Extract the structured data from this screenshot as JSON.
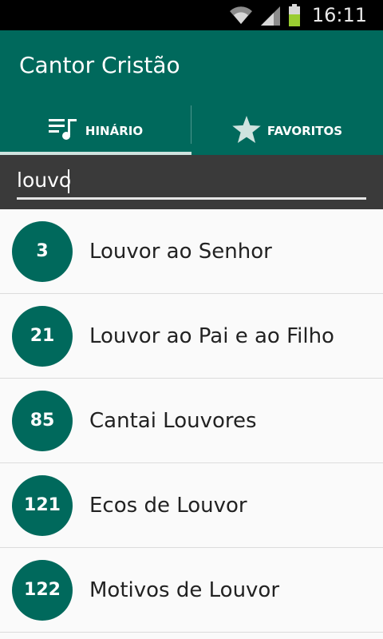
{
  "status_bar": {
    "time": "16:11"
  },
  "app": {
    "title": "Cantor Cristão"
  },
  "tabs": [
    {
      "label": "HINÁRIO",
      "icon": "playlist-music-icon",
      "active": true
    },
    {
      "label": "FAVORITOS",
      "icon": "star-icon",
      "active": false
    }
  ],
  "search": {
    "value": "louvo"
  },
  "hymns": [
    {
      "number": "3",
      "title": "Louvor ao Senhor"
    },
    {
      "number": "21",
      "title": "Louvor ao Pai e ao Filho"
    },
    {
      "number": "85",
      "title": "Cantai Louvores"
    },
    {
      "number": "121",
      "title": "Ecos de Louvor"
    },
    {
      "number": "122",
      "title": "Motivos de Louvor"
    }
  ],
  "colors": {
    "primary": "#00695c",
    "search_bg": "#3a3a3a"
  }
}
